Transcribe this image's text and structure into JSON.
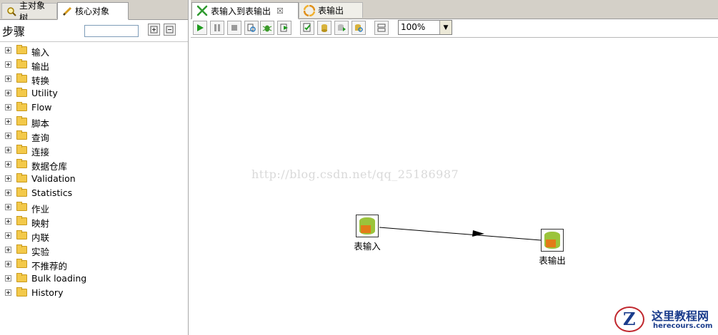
{
  "left_panel": {
    "tabs": [
      {
        "label": "主对象树"
      },
      {
        "label": "核心对象"
      }
    ],
    "steps_label": "步骤",
    "search_value": "",
    "tree_items": [
      {
        "label": "输入"
      },
      {
        "label": "输出"
      },
      {
        "label": "转换"
      },
      {
        "label": "Utility"
      },
      {
        "label": "Flow"
      },
      {
        "label": "脚本"
      },
      {
        "label": "查询"
      },
      {
        "label": "连接"
      },
      {
        "label": "数据仓库"
      },
      {
        "label": "Validation"
      },
      {
        "label": "Statistics"
      },
      {
        "label": "作业"
      },
      {
        "label": "映射"
      },
      {
        "label": "内联"
      },
      {
        "label": "实验"
      },
      {
        "label": "不推荐的"
      },
      {
        "label": "Bulk loading"
      },
      {
        "label": "History"
      }
    ]
  },
  "editor": {
    "tabs": [
      {
        "label": "表输入到表输出",
        "close": "☒"
      },
      {
        "label": "表输出"
      }
    ],
    "zoom": "100%",
    "watermark": "http://blog.csdn.net/qq_25186987",
    "steps": [
      {
        "label": "表输入"
      },
      {
        "label": "表输出"
      }
    ]
  },
  "logo": {
    "letter": "Z",
    "title": "这里教程网",
    "url": "herecours.com"
  },
  "colors": {
    "accent_green": "#9bc43b",
    "accent_orange": "#e37b18",
    "logo_blue": "#1a3c8c",
    "logo_red": "#c0272d"
  }
}
